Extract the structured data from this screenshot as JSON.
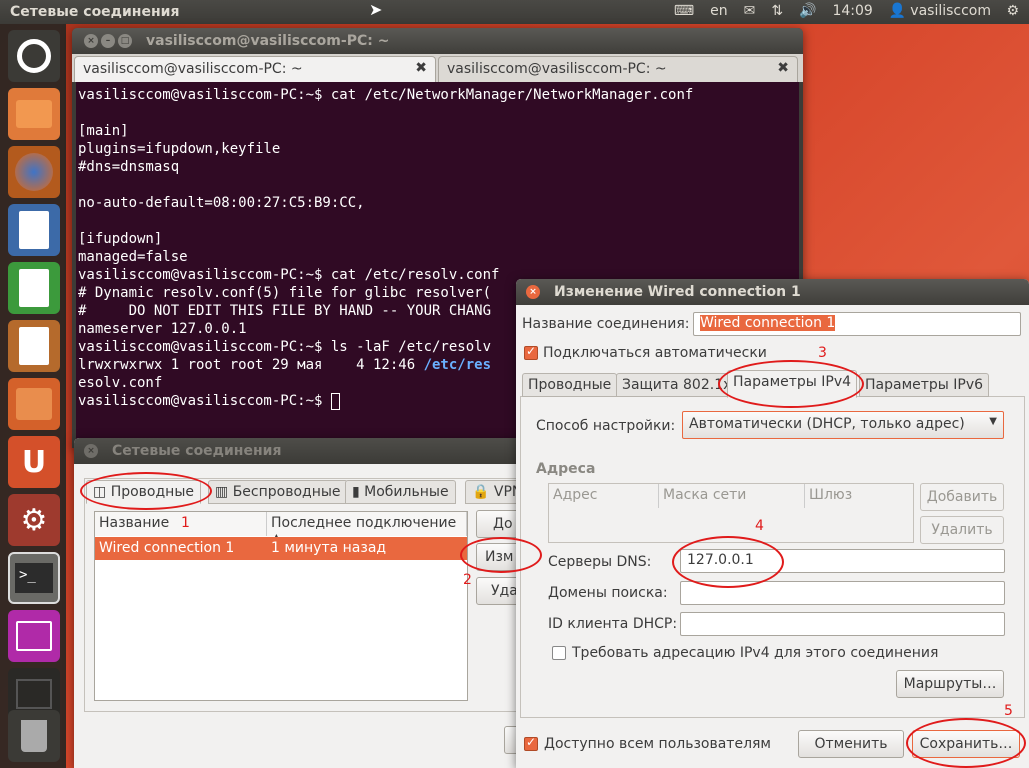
{
  "topbar": {
    "title": "Сетевые соединения",
    "lang": "en",
    "time": "14:09",
    "user": "vasilisccom"
  },
  "terminal": {
    "title": "vasilisccom@vasilisccom-PC: ~",
    "tabs": [
      {
        "label": "vasilisccom@vasilisccom-PC: ~"
      },
      {
        "label": "vasilisccom@vasilisccom-PC: ~"
      }
    ],
    "lines": [
      "vasilisccom@vasilisccom-PC:~$ cat /etc/NetworkManager/NetworkManager.conf",
      "",
      "[main]",
      "plugins=ifupdown,keyfile",
      "#dns=dnsmasq",
      "",
      "no-auto-default=08:00:27:C5:B9:CC,",
      "",
      "[ifupdown]",
      "managed=false",
      "vasilisccom@vasilisccom-PC:~$ cat /etc/resolv.conf",
      "# Dynamic resolv.conf(5) file for glibc resolver(",
      "#     DO NOT EDIT THIS FILE BY HAND -- YOUR CHANG",
      "nameserver 127.0.0.1",
      "vasilisccom@vasilisccom-PC:~$ ls -laF /etc/resolv"
    ],
    "ls_line": "lrwxrwxrwx 1 root root 29 мая    4 12:46 ",
    "ls_link": "/etc/res",
    "line_wrap": "esolv.conf",
    "prompt": "vasilisccom@vasilisccom-PC:~$ "
  },
  "network": {
    "title": "Сетевые соединения",
    "tabs": [
      "Проводные",
      "Беспроводные",
      "Мобильные",
      "VPN"
    ],
    "columns": [
      "Название",
      "Последнее подключение ▲"
    ],
    "rows": [
      {
        "name": "Wired connection 1",
        "last": "1 минута назад"
      }
    ],
    "buttons": {
      "add": "До",
      "edit": "Изм",
      "delete": "Уда"
    }
  },
  "dialog": {
    "title": "Изменение Wired connection 1",
    "name_label": "Название соединения:",
    "name_value": "Wired connection 1",
    "auto_connect": "Подключаться автоматически",
    "tabs": [
      "Проводные",
      "Защита 802.1x",
      "Параметры IPv4",
      "Параметры IPv6"
    ],
    "method_label": "Способ настройки:",
    "method_value": "Автоматически (DHCP, только адрес)",
    "addresses_label": "Адреса",
    "addr_cols": [
      "Адрес",
      "Маска сети",
      "Шлюз"
    ],
    "add_btn": "Добавить",
    "del_btn": "Удалить",
    "dns_label": "Серверы DNS:",
    "dns_value": "127.0.0.1",
    "search_label": "Домены поиска:",
    "dhcp_label": "ID клиента DHCP:",
    "require_ipv4": "Требовать адресацию IPv4 для этого соединения",
    "routes_btn": "Маршруты…",
    "all_users": "Доступно всем пользователям",
    "cancel": "Отменить",
    "save": "Сохранить…"
  },
  "annotations": [
    "1",
    "2",
    "3",
    "4",
    "5"
  ],
  "colors": {
    "accent": "#e9683f",
    "terminal_bg": "#300a24",
    "annotation": "#e01b1b"
  }
}
